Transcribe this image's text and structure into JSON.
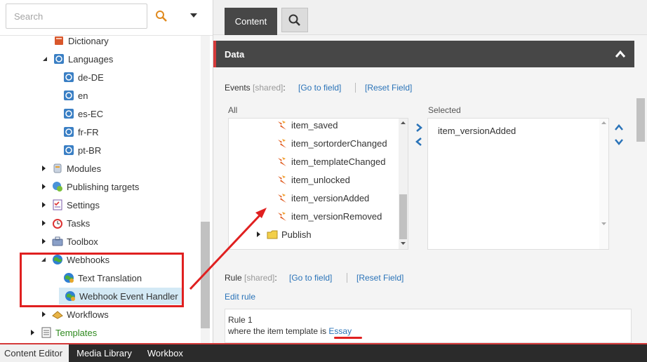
{
  "tree": {
    "search_placeholder": "Search",
    "items": [
      {
        "label": "Dictionary"
      },
      {
        "label": "Languages"
      },
      {
        "label": "de-DE"
      },
      {
        "label": "en"
      },
      {
        "label": "es-EC"
      },
      {
        "label": "fr-FR"
      },
      {
        "label": "pt-BR"
      },
      {
        "label": "Modules"
      },
      {
        "label": "Publishing targets"
      },
      {
        "label": "Settings"
      },
      {
        "label": "Tasks"
      },
      {
        "label": "Toolbox"
      },
      {
        "label": "Webhooks"
      },
      {
        "label": "Text Translation"
      },
      {
        "label": "Webhook Event Handler"
      },
      {
        "label": "Workflows"
      },
      {
        "label": "Templates"
      }
    ]
  },
  "editor": {
    "tabs": {
      "content_label": "Content"
    },
    "section": {
      "title": "Data"
    },
    "events_field": {
      "label": "Events",
      "shared": "[shared]",
      "colon": ":",
      "goto": "[Go to field]",
      "reset": "[Reset Field]",
      "all_caption": "All",
      "selected_caption": "Selected",
      "all_items": [
        "item_saved",
        "item_sortorderChanged",
        "item_templateChanged",
        "item_unlocked",
        "item_versionAdded",
        "item_versionRemoved",
        "Publish"
      ],
      "selected_items": [
        "item_versionAdded"
      ]
    },
    "rule_field": {
      "label": "Rule",
      "shared": "[shared]",
      "colon": ":",
      "goto": "[Go to field]",
      "reset": "[Reset Field]",
      "edit_rule": "Edit rule",
      "rule_title": "Rule 1",
      "rule_text": "where the item template is ",
      "rule_link": "Essay"
    }
  },
  "bottom_tabs": [
    "Content Editor",
    "Media Library",
    "Workbox"
  ],
  "colors": {
    "accent_red": "#e02020",
    "link_blue": "#2a73b8",
    "dark_header": "#474747",
    "selected_row": "#d3e9f5"
  }
}
